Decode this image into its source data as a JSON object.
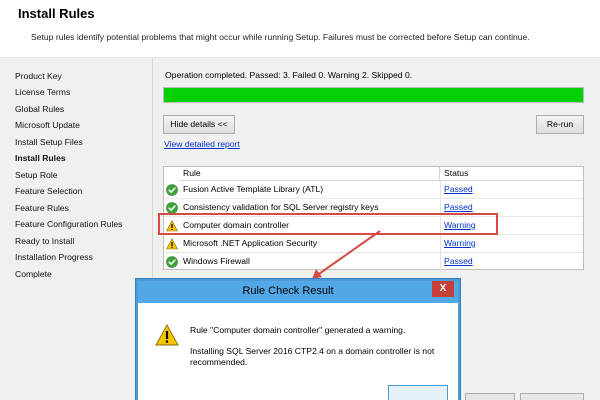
{
  "header": {
    "title": "Install Rules",
    "subtitle": "Setup rules identify potential problems that might occur while running Setup. Failures must be corrected before Setup can continue."
  },
  "sidebar": {
    "items": [
      {
        "label": "Product Key",
        "active": false
      },
      {
        "label": "License Terms",
        "active": false
      },
      {
        "label": "Global Rules",
        "active": false
      },
      {
        "label": "Microsoft Update",
        "active": false
      },
      {
        "label": "Install Setup Files",
        "active": false
      },
      {
        "label": "Install Rules",
        "active": true
      },
      {
        "label": "Setup Role",
        "active": false
      },
      {
        "label": "Feature Selection",
        "active": false
      },
      {
        "label": "Feature Rules",
        "active": false
      },
      {
        "label": "Feature Configuration Rules",
        "active": false
      },
      {
        "label": "Ready to Install",
        "active": false
      },
      {
        "label": "Installation Progress",
        "active": false
      },
      {
        "label": "Complete",
        "active": false
      }
    ]
  },
  "main": {
    "status_text": "Operation completed. Passed: 3.   Failed 0.   Warning 2.   Skipped 0.",
    "progress_fraction": 1.0,
    "hide_details_label": "Hide details <<",
    "rerun_label": "Re-run",
    "view_report_label": "View detailed report",
    "table": {
      "headers": {
        "rule": "Rule",
        "status": "Status"
      },
      "rows": [
        {
          "icon": "check-icon",
          "rule": "Fusion Active Template Library (ATL)",
          "status": "Passed"
        },
        {
          "icon": "check-icon",
          "rule": "Consistency validation for SQL Server registry keys",
          "status": "Passed"
        },
        {
          "icon": "warning-icon",
          "rule": "Computer domain controller",
          "status": "Warning"
        },
        {
          "icon": "warning-icon",
          "rule": "Microsoft .NET Application Security",
          "status": "Warning"
        },
        {
          "icon": "check-icon",
          "rule": "Windows Firewall",
          "status": "Passed"
        }
      ]
    }
  },
  "dialog": {
    "title": "Rule Check Result",
    "close_label": "X",
    "message1": "Rule \"Computer domain controller\" generated a warning.",
    "message2": "Installing SQL Server 2016 CTP2.4 on a domain controller is not recommended."
  },
  "colors": {
    "progress_fill": "#06d106",
    "link": "#0033cc",
    "highlight": "#d44a45",
    "dialog_title": "#52a7e6"
  }
}
